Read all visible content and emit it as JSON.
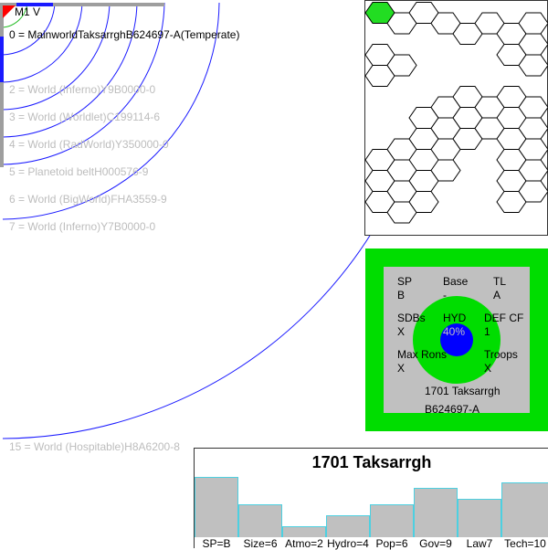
{
  "star": {
    "label": "M1 V"
  },
  "systems": [
    {
      "text": "0 = MainworldTaksarrghB624697-A(Temperate)",
      "main": true
    },
    {
      "text": "2 = World  (Inferno)Y9B0000-0",
      "main": false
    },
    {
      "text": "3 = World  (Worldlet)C199114-6",
      "main": false
    },
    {
      "text": "4 = World  (RadWorld)Y350000-0",
      "main": false
    },
    {
      "text": "5 = Planetoid beltH000576-9",
      "main": false
    },
    {
      "text": "6 = World  (BigWorld)FHA3559-9",
      "main": false
    },
    {
      "text": "7 = World  (Inferno)Y7B0000-0",
      "main": false
    },
    {
      "text": "15 = World  (Hospitable)H8A6200-8",
      "main": false
    }
  ],
  "world_panel": {
    "sp_label": "SP",
    "sp_value": "B",
    "base_label": "Base",
    "base_value": "-",
    "tl_label": "TL",
    "tl_value": "A",
    "sdbs_label": "SDBs",
    "sdbs_value": "X",
    "hyd_label": "HYD",
    "hyd_value": "40%",
    "def_label": "DEF CF",
    "def_value": "1",
    "maxrons_label": "Max Rons",
    "maxrons_value": "X",
    "troops_label": "Troops",
    "troops_value": "X",
    "name": "1701 Taksarrgh",
    "uwp": "B624697-A"
  },
  "colors": {
    "orbit": "#1a1aff",
    "hex_highlight": "#22dd22",
    "panel_green": "#00dd00",
    "panel_gray": "#c0c0c0",
    "hyd_blue": "#0000ff",
    "bar_border": "#4dd0e1"
  },
  "chart_data": {
    "type": "bar",
    "title": "1701 Taksarrgh",
    "categories": [
      "SP=B",
      "Size=6",
      "Atmo=2",
      "Hydro=4",
      "Pop=6",
      "Gov=9",
      "Law7",
      "Tech=10"
    ],
    "values": [
      11,
      6,
      2,
      4,
      6,
      9,
      7,
      10
    ],
    "ylim": [
      0,
      12
    ]
  }
}
